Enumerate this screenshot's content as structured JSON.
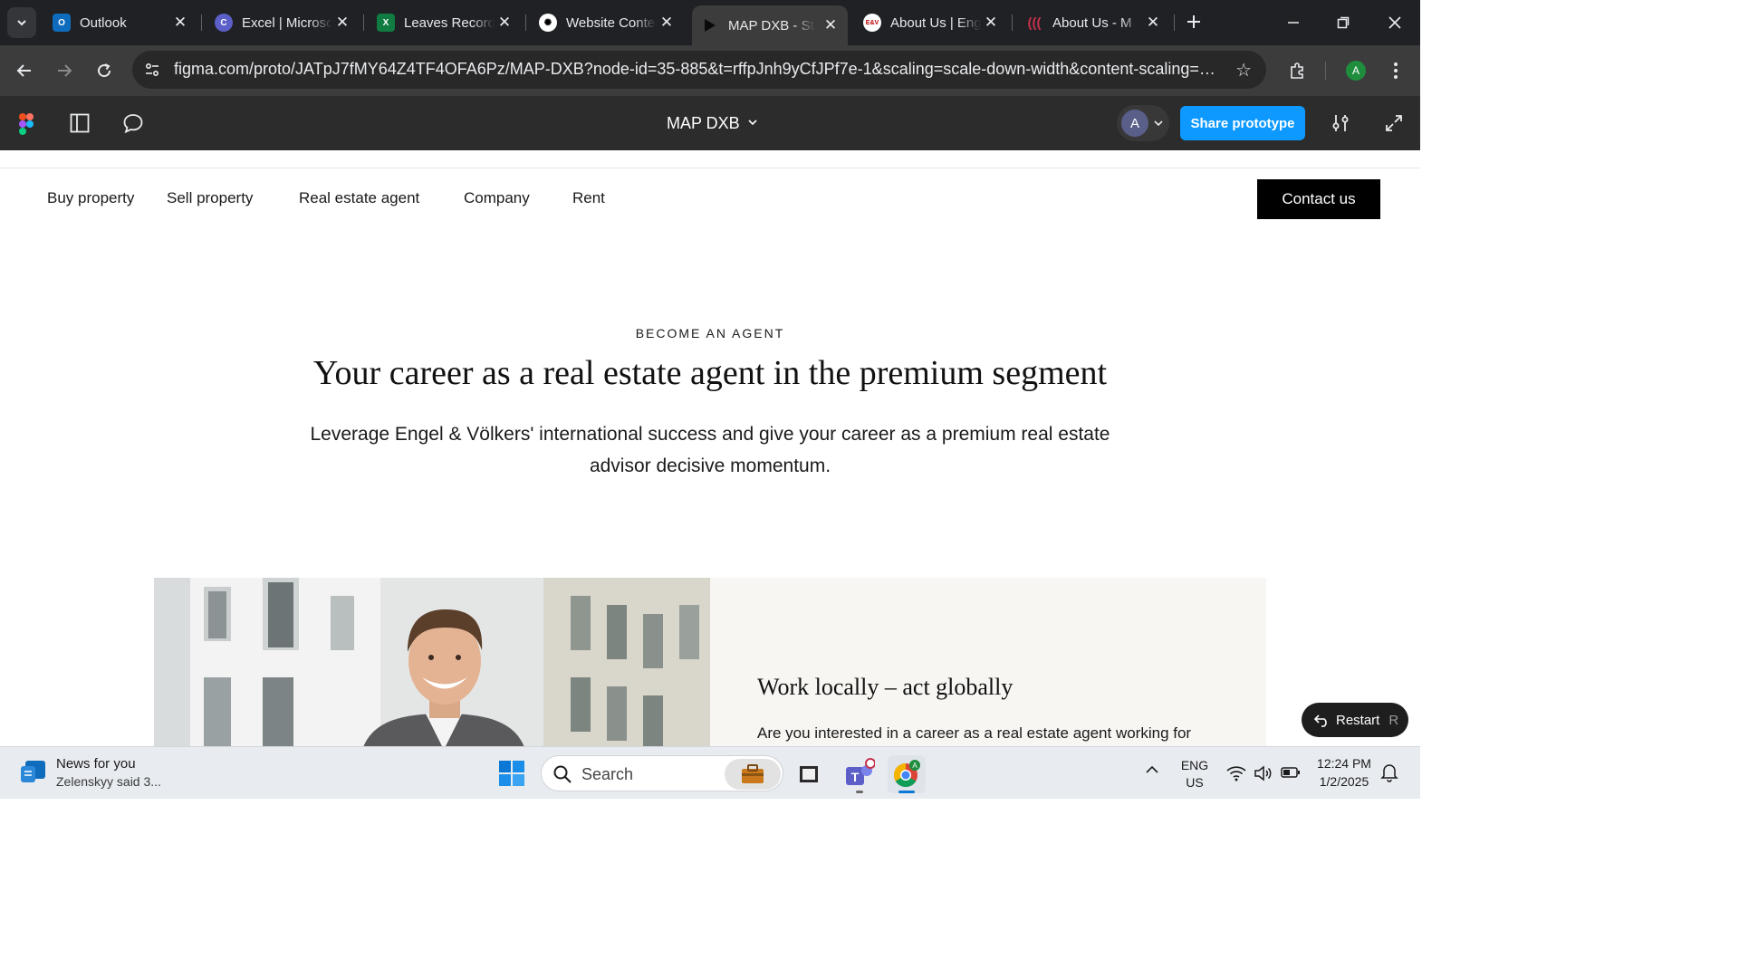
{
  "browser": {
    "tabs": [
      {
        "title": "Outlook",
        "favicon": "outlook-icon",
        "color": "#0f6cbd",
        "glyph": "O"
      },
      {
        "title": "Excel | Microsoft",
        "favicon": "copilot-icon",
        "color": "#5b5fc7",
        "glyph": "C"
      },
      {
        "title": "Leaves Record",
        "favicon": "excel-icon",
        "color": "#107c41",
        "glyph": "X"
      },
      {
        "title": "Website Content",
        "favicon": "chatgpt-icon",
        "color": "#ffffff",
        "glyph": "⚙"
      },
      {
        "title": "MAP DXB - St",
        "favicon": "figma-play-icon",
        "color": "#000000",
        "glyph": "▶",
        "active": true
      },
      {
        "title": "About Us | Eng",
        "favicon": "ev-icon",
        "color": "#ffffff",
        "glyph": "E&V"
      },
      {
        "title": "About Us - M",
        "favicon": "brand-icon",
        "color": "#b3261e",
        "glyph": "((("
      }
    ],
    "url": "figma.com/proto/JATpJ7fMY64Z4TF4OFA6Pz/MAP-DXB?node-id=35-885&t=rffpJnh9yCfJPf7e-1&scaling=scale-down-width&content-scaling=fixed&p...",
    "profile_initial": "A"
  },
  "figma": {
    "file_name": "MAP DXB",
    "avatar_initial": "A",
    "share_label": "Share prototype"
  },
  "site": {
    "nav": [
      "Buy property",
      "Sell property",
      "Real estate agent",
      "Company",
      "Rent"
    ],
    "contact_label": "Contact us",
    "eyebrow": "BECOME AN AGENT",
    "title": "Your career as a real estate agent in the premium segment",
    "body": "Leverage Engel & Völkers' international success and give your career as a premium real estate advisor decisive momentum.",
    "card_title": "Work locally – act globally",
    "card_body": "Are you interested in a career as a real estate agent working for",
    "restart_label": "Restart",
    "restart_key": "R"
  },
  "taskbar": {
    "news_title": "News for you",
    "news_sub": "Zelenskyy said 3...",
    "search_placeholder": "Search",
    "lang_top": "ENG",
    "lang_bottom": "US",
    "time": "12:24 PM",
    "date": "1/2/2025"
  }
}
